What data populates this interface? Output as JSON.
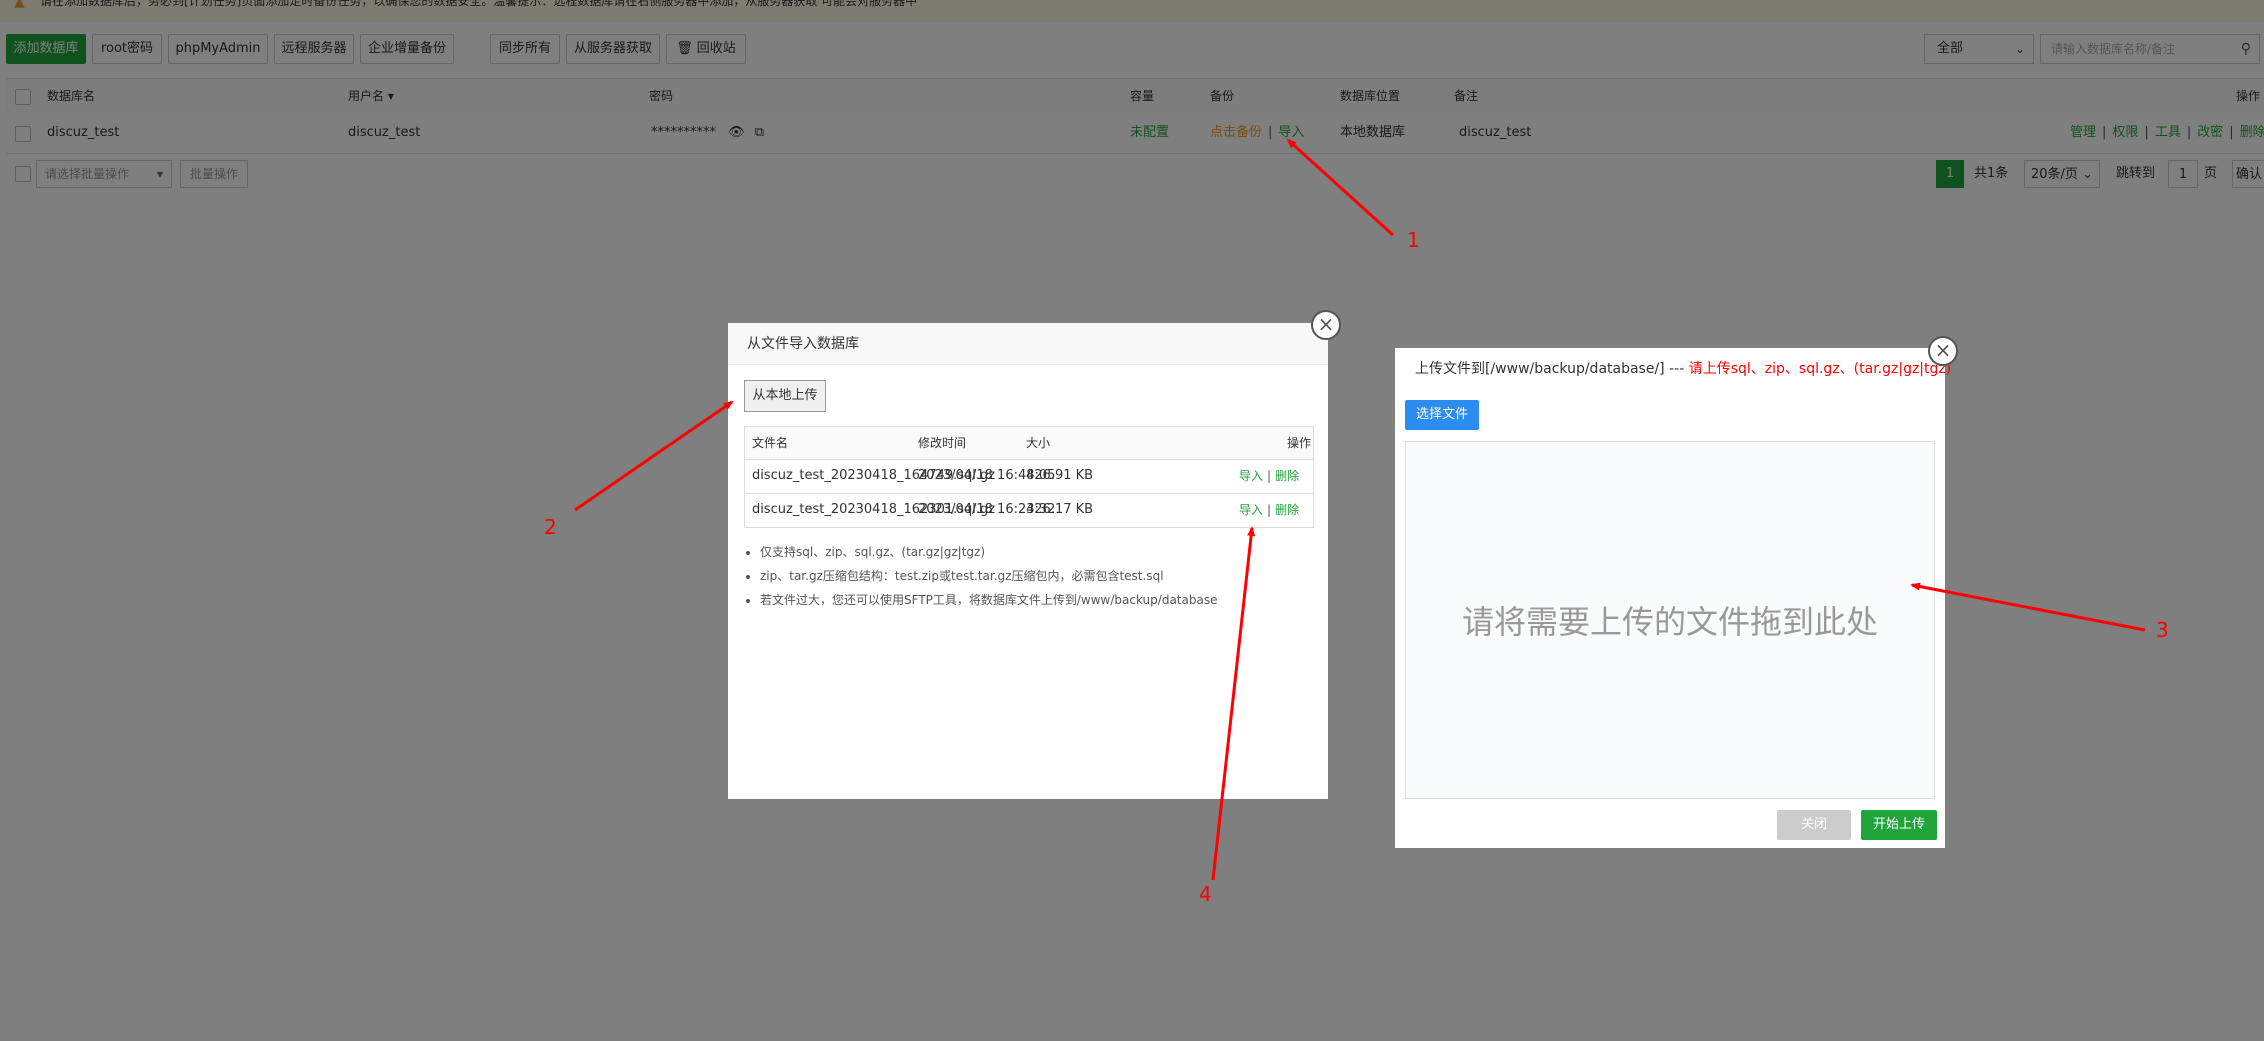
{
  "notice": {
    "text": "请在添加数据库后，务必到[计划任务]页面添加定时备份任务，以确保您的数据安全。温馨提示：远程数据库请在右侧服务器中添加，从服务器获取 可能会对服务器中"
  },
  "toolbar": {
    "add_db": "添加数据库",
    "root_password": "root密码",
    "phpmyadmin": "phpMyAdmin",
    "remote_server": "远程服务器",
    "enterprise_backup": "企业增量备份",
    "sync_all": "同步所有",
    "fetch_from_server": "从服务器获取",
    "recycle_bin": "回收站",
    "filter_value": "全部",
    "search_placeholder": "请输入数据库名称/备注"
  },
  "table": {
    "headers": {
      "name": "数据库名",
      "user": "用户名",
      "password": "密码",
      "capacity": "容量",
      "backup": "备份",
      "location": "数据库位置",
      "note": "备注",
      "actions": "操作"
    },
    "rows": [
      {
        "name": "discuz_test",
        "user": "discuz_test",
        "password": "**********",
        "capacity": "未配置",
        "backup_click": "点击备份",
        "import": "导入",
        "location": "本地数据库",
        "note": "discuz_test",
        "actions": [
          "管理",
          "权限",
          "工具",
          "改密",
          "删除"
        ]
      }
    ]
  },
  "footer": {
    "batch_placeholder": "请选择批量操作",
    "batch_button": "批量操作",
    "current_page": "1",
    "total": "共1条",
    "per_page": "20条/页",
    "jump_to": "跳转到",
    "jump_value": "1",
    "page_unit": "页",
    "confirm": "确认"
  },
  "import_dialog": {
    "title": "从文件导入数据库",
    "upload_local": "从本地上传",
    "headers": {
      "filename": "文件名",
      "mtime": "修改时间",
      "size": "大小",
      "op": "操作"
    },
    "files": [
      {
        "name": "discuz_test_20230418_164749.sql.gz",
        "mtime": "2023/04/18 16:48:05",
        "size": "426.91 KB",
        "import": "导入",
        "delete": "删除"
      },
      {
        "name": "discuz_test_20230418_162301.sql.gz",
        "mtime": "2023/04/18 16:23:32",
        "size": "426.17 KB",
        "import": "导入",
        "delete": "删除"
      }
    ],
    "notes": [
      "仅支持sql、zip、sql.gz、(tar.gz|gz|tgz)",
      "zip、tar.gz压缩包结构：test.zip或test.tar.gz压缩包内，必需包含test.sql",
      "若文件过大，您还可以使用SFTP工具，将数据库文件上传到/www/backup/database"
    ]
  },
  "upload_dialog": {
    "title_prefix": "上传文件到[/www/backup/database/] ---",
    "title_hint": "请上传sql、zip、sql.gz、(tar.gz|gz|tgz)",
    "choose_file": "选择文件",
    "drop_text": "请将需要上传的文件拖到此处",
    "close": "关闭",
    "start": "开始上传"
  },
  "annotations": [
    "1",
    "2",
    "3",
    "4"
  ],
  "colors": {
    "brand_green": "#20a53a",
    "annotation_red": "#ff0000",
    "primary_blue": "#2d8cf0",
    "warning_orange": "#f39c12"
  }
}
